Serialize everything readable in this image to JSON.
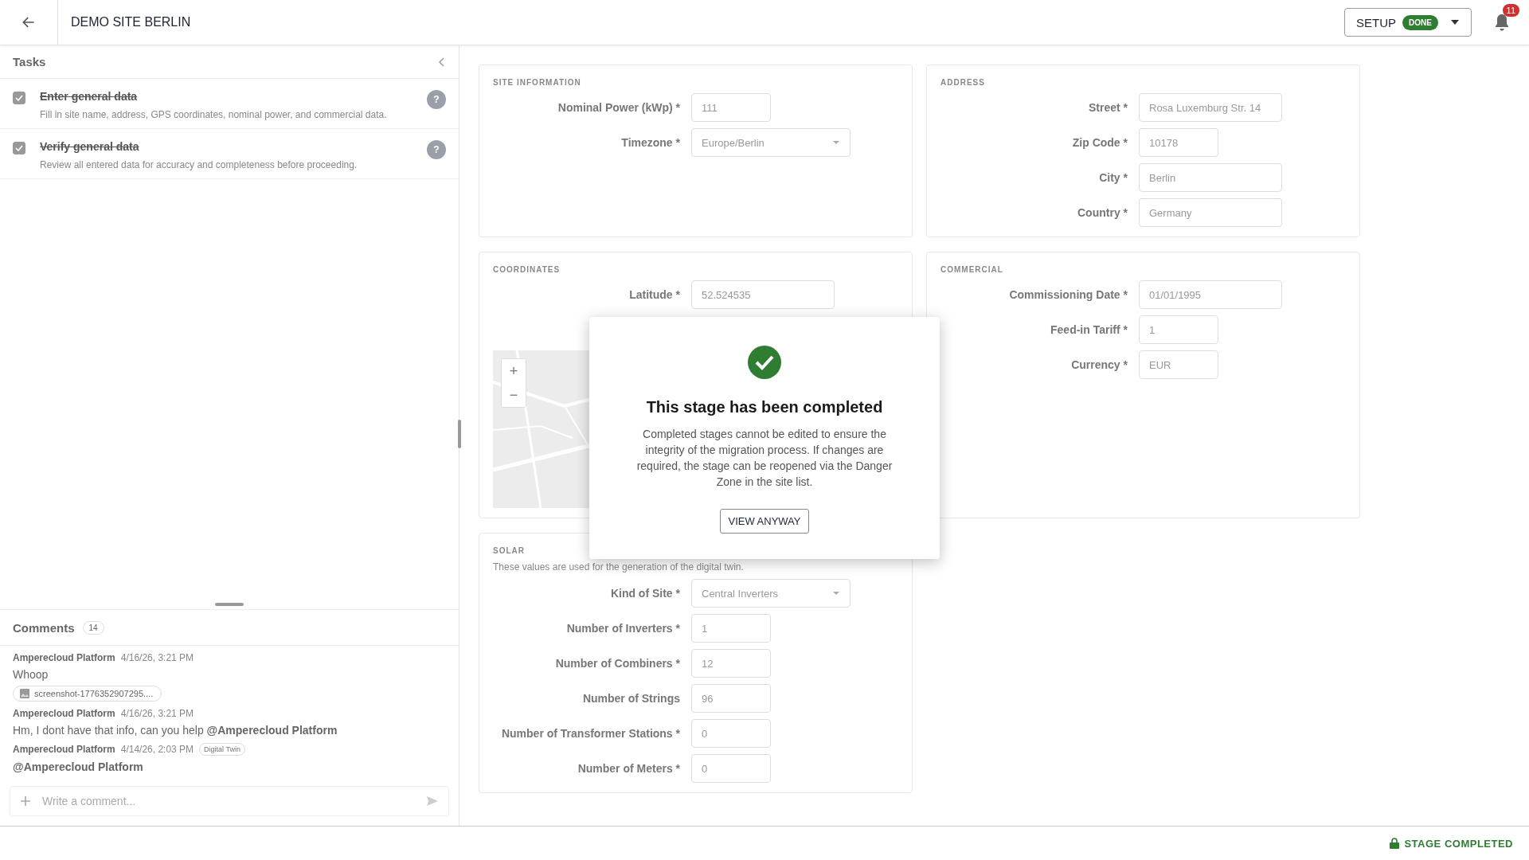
{
  "header": {
    "title": "DEMO SITE BERLIN",
    "stage": {
      "label": "SETUP",
      "badge": "DONE"
    },
    "notifications": "11"
  },
  "tasks": {
    "title": "Tasks",
    "items": [
      {
        "title": "Enter general data",
        "description": "Fill in site name, address, GPS coordinates, nominal power, and commercial data.",
        "done": true,
        "help": "?"
      },
      {
        "title": "Verify general data",
        "description": "Review all entered data for accuracy and completeness before proceeding.",
        "done": true,
        "help": "?"
      }
    ]
  },
  "comments": {
    "title": "Comments",
    "count": "14",
    "placeholder": "Write a comment...",
    "items": [
      {
        "author": "Amperecloud Platform",
        "time": "4/16/26, 3:21 PM",
        "text": "Whoop",
        "attachment": "screenshot-1776352907295...."
      },
      {
        "author": "Amperecloud Platform",
        "time": "4/16/26, 3:21 PM",
        "text": "Hm, I dont have that info, can you help",
        "mention": "@Amperecloud Platform"
      },
      {
        "author": "Amperecloud Platform",
        "time": "4/14/26, 2:03 PM",
        "tag": "Digital Twin",
        "mention": "@Amperecloud Platform"
      }
    ]
  },
  "sections": [
    {
      "title": "SITE INFORMATION",
      "fields": [
        {
          "label": "Nominal Power (kWp) *",
          "value": "111",
          "kind": "short"
        },
        {
          "label": "Timezone *",
          "value": "Europe/Berlin",
          "kind": "select"
        }
      ]
    },
    {
      "title": "ADDRESS",
      "fields": [
        {
          "label": "Street *",
          "value": "Rosa Luxemburg Str. 14",
          "kind": "long"
        },
        {
          "label": "Zip Code *",
          "value": "10178",
          "kind": "short"
        },
        {
          "label": "City *",
          "value": "Berlin",
          "kind": "long"
        },
        {
          "label": "Country *",
          "value": "Germany",
          "kind": "long"
        }
      ]
    },
    {
      "title": "COORDINATES",
      "fields": [
        {
          "label": "Latitude *",
          "value": "52.524535",
          "kind": "medium"
        }
      ],
      "map": {
        "zoom_in": "+",
        "zoom_out": "−"
      }
    },
    {
      "title": "COMMERCIAL",
      "fields": [
        {
          "label": "Commissioning Date *",
          "value": "01/01/1995",
          "kind": "long"
        },
        {
          "label": "Feed-in Tariff *",
          "value": "1",
          "kind": "short"
        },
        {
          "label": "Currency *",
          "value": "EUR",
          "kind": "short"
        }
      ]
    },
    {
      "title": "SOLAR",
      "description": "These values are used for the generation of the digital twin.",
      "fields": [
        {
          "label": "Kind of Site *",
          "value": "Central Inverters",
          "kind": "select"
        },
        {
          "label": "Number of Inverters *",
          "value": "1",
          "kind": "short"
        },
        {
          "label": "Number of Combiners *",
          "value": "12",
          "kind": "short"
        },
        {
          "label": "Number of Strings",
          "value": "96",
          "kind": "short"
        },
        {
          "label": "Number of Transformer Stations *",
          "value": "0",
          "kind": "short"
        },
        {
          "label": "Number of Meters *",
          "value": "0",
          "kind": "short"
        }
      ]
    }
  ],
  "dialog": {
    "title": "This stage has been completed",
    "body": "Completed stages cannot be edited to ensure the integrity of the migration process. If changes are required, the stage can be reopened via the Danger Zone in the site list.",
    "button": "VIEW ANYWAY"
  },
  "status_bar": {
    "text": "STAGE COMPLETED"
  }
}
